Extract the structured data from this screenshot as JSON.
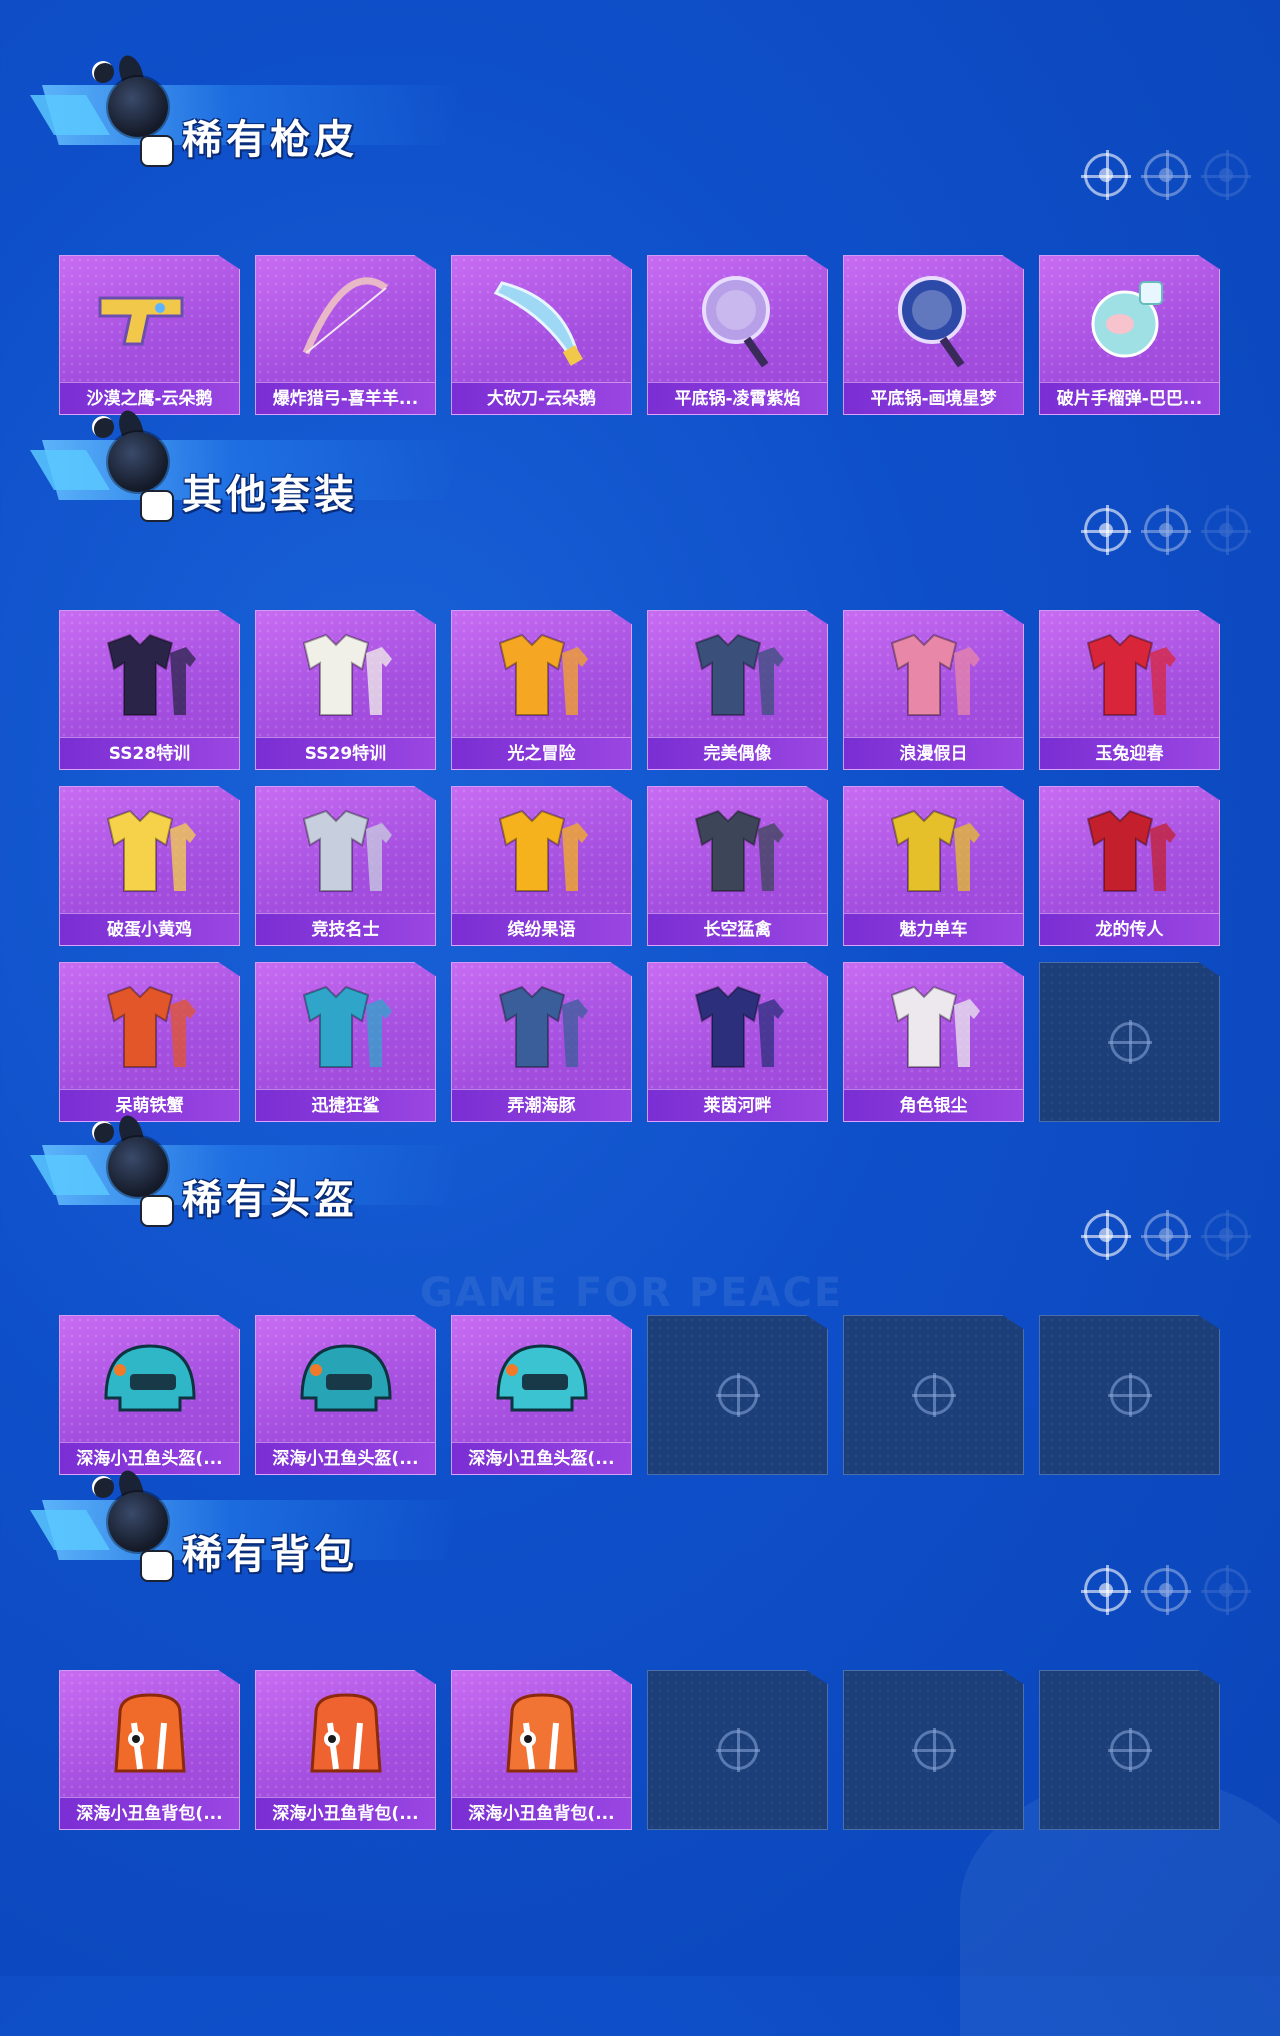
{
  "sections": [
    {
      "title": "稀有枪皮",
      "items": [
        {
          "label": "沙漠之鹰-云朵鹅",
          "icon": "pistol-icon",
          "color": "#f2c84b"
        },
        {
          "label": "爆炸猎弓-喜羊羊...",
          "icon": "bow-icon",
          "color": "#e8b7c8"
        },
        {
          "label": "大砍刀-云朵鹅",
          "icon": "machete-icon",
          "color": "#9fd8f4"
        },
        {
          "label": "平底锅-凌霄紫焰",
          "icon": "pan-icon",
          "color": "#b7a0e8"
        },
        {
          "label": "平底锅-画境星梦",
          "icon": "pan-icon",
          "color": "#2d4aa8"
        },
        {
          "label": "破片手榴弹-巴巴...",
          "icon": "grenade-icon",
          "color": "#9fe0e4"
        }
      ],
      "empty_slots": 0
    },
    {
      "title": "其他套装",
      "items": [
        {
          "label": "SS28特训",
          "icon": "outfit-icon",
          "color": "#2a2448"
        },
        {
          "label": "SS29特训",
          "icon": "outfit-icon",
          "color": "#f1f0e8"
        },
        {
          "label": "光之冒险",
          "icon": "outfit-icon",
          "color": "#f5a623"
        },
        {
          "label": "完美偶像",
          "icon": "outfit-icon",
          "color": "#3a4f7a"
        },
        {
          "label": "浪漫假日",
          "icon": "outfit-icon",
          "color": "#e887a8"
        },
        {
          "label": "玉兔迎春",
          "icon": "outfit-icon",
          "color": "#d8253a"
        },
        {
          "label": "破蛋小黄鸡",
          "icon": "outfit-icon",
          "color": "#f6d24a"
        },
        {
          "label": "竞技名士",
          "icon": "outfit-icon",
          "color": "#c7cede"
        },
        {
          "label": "缤纷果语",
          "icon": "outfit-icon",
          "color": "#f5b21c"
        },
        {
          "label": "长空猛禽",
          "icon": "outfit-icon",
          "color": "#3c4658"
        },
        {
          "label": "魅力单车",
          "icon": "outfit-icon",
          "color": "#e5c02a"
        },
        {
          "label": "龙的传人",
          "icon": "outfit-icon",
          "color": "#c31f2c"
        },
        {
          "label": "呆萌铁蟹",
          "icon": "outfit-icon",
          "color": "#e2562a"
        },
        {
          "label": "迅捷狂鲨",
          "icon": "outfit-icon",
          "color": "#2fa6c9"
        },
        {
          "label": "弄潮海豚",
          "icon": "outfit-icon",
          "color": "#3a5e9a"
        },
        {
          "label": "莱茵河畔",
          "icon": "outfit-icon",
          "color": "#2b2f7c"
        },
        {
          "label": "角色银尘",
          "icon": "outfit-icon",
          "color": "#ece8ee"
        }
      ],
      "empty_slots": 1
    },
    {
      "title": "稀有头盔",
      "items": [
        {
          "label": "深海小丑鱼头盔(...",
          "icon": "helmet-icon",
          "color": "#2fb7c8"
        },
        {
          "label": "深海小丑鱼头盔(...",
          "icon": "helmet-icon",
          "color": "#27a5b6"
        },
        {
          "label": "深海小丑鱼头盔(...",
          "icon": "helmet-icon",
          "color": "#3cc3d2"
        }
      ],
      "empty_slots": 3
    },
    {
      "title": "稀有背包",
      "items": [
        {
          "label": "深海小丑鱼背包(...",
          "icon": "backpack-icon",
          "color": "#f06a2a"
        },
        {
          "label": "深海小丑鱼背包(...",
          "icon": "backpack-icon",
          "color": "#ef6330"
        },
        {
          "label": "深海小丑鱼背包(...",
          "icon": "backpack-icon",
          "color": "#f27435"
        }
      ],
      "empty_slots": 3
    }
  ],
  "watermark": "GAME FOR PEACE"
}
